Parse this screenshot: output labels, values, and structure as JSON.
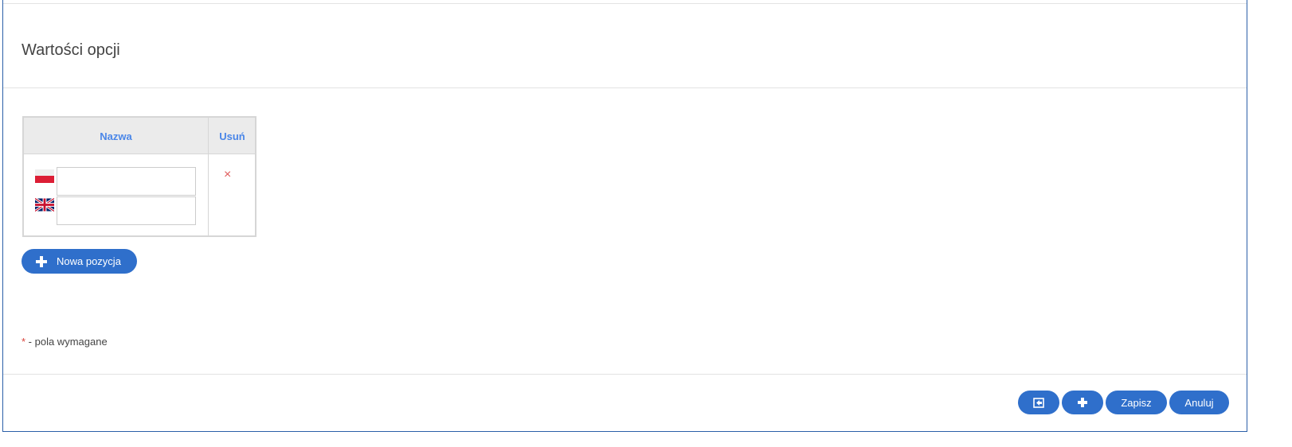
{
  "section": {
    "title": "Wartości opcji"
  },
  "table": {
    "headers": {
      "name": "Nazwa",
      "delete": "Usuń"
    },
    "rows": [
      {
        "inputs": [
          {
            "lang": "pl",
            "flag_icon": "poland-flag-icon",
            "value": "",
            "placeholder": ""
          },
          {
            "lang": "en",
            "flag_icon": "uk-flag-icon",
            "value": "",
            "placeholder": ""
          }
        ],
        "delete_symbol": "×"
      }
    ]
  },
  "buttons": {
    "new_item_label": "Nowa pozycja",
    "save_label": "Zapisz",
    "cancel_label": "Anuluj"
  },
  "note": {
    "star": "*",
    "text": " - pola wymagane"
  },
  "colors": {
    "accent": "#2f6fcb",
    "header_text": "#4a86e8",
    "delete": "#e05a5a",
    "required": "#d9443c"
  }
}
